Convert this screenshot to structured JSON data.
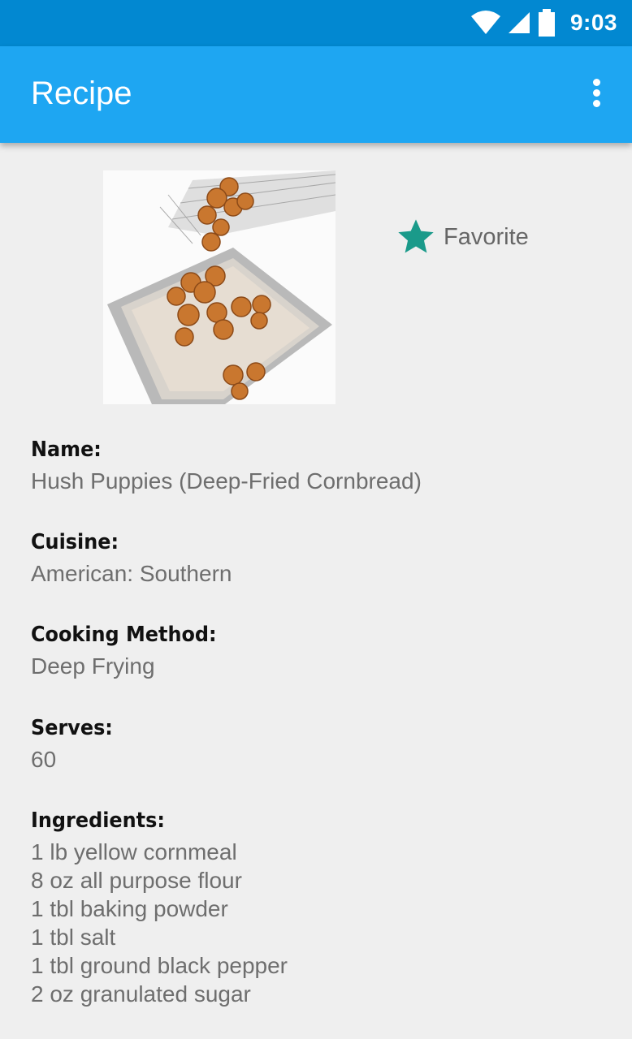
{
  "status_bar": {
    "time": "9:03",
    "icons": [
      "wifi-icon",
      "signal-icon",
      "battery-icon"
    ]
  },
  "app_bar": {
    "title": "Recipe",
    "overflow_icon": "more-vert-icon"
  },
  "favorite": {
    "label": "Favorite",
    "icon": "star-icon",
    "color": "#1a9a8a"
  },
  "recipe": {
    "name_label": "Name:",
    "name": "Hush Puppies (Deep-Fried Cornbread)",
    "cuisine_label": "Cuisine:",
    "cuisine": "American: Southern",
    "method_label": "Cooking Method:",
    "method": "Deep Frying",
    "serves_label": "Serves:",
    "serves": "60",
    "ingredients_label": "Ingredients:",
    "ingredients": [
      "1 lb yellow cornmeal",
      "8 oz all purpose flour",
      "1 tbl baking powder",
      "1 tbl salt",
      "1 tbl ground black pepper",
      "2 oz granulated sugar"
    ]
  },
  "colors": {
    "status_bar": "#0288d1",
    "app_bar": "#1ea6f2",
    "background": "#efefef"
  }
}
